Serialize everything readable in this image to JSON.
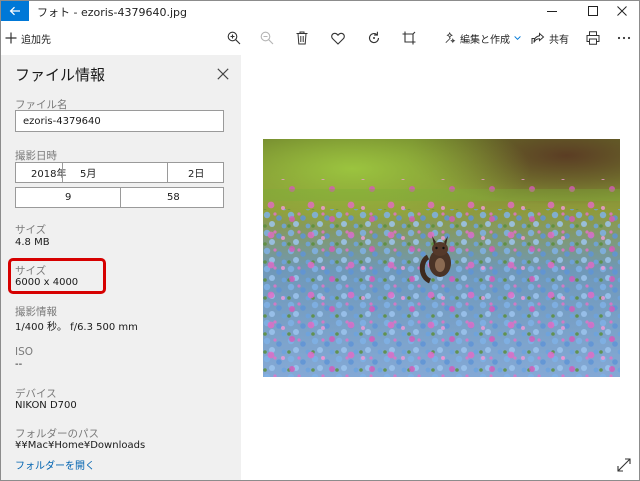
{
  "window": {
    "title": "フォト - ezoris-4379640.jpg"
  },
  "toolbar": {
    "add_label": "追加先",
    "edit_label": "編集と作成",
    "share_label": "共有",
    "icons": [
      "back-arrow-icon",
      "plus-icon",
      "zoom-in-icon",
      "zoom-out-icon",
      "trash-icon",
      "heart-icon",
      "rotate-icon",
      "crop-icon",
      "edit-create-icon",
      "chevron-down-icon",
      "share-icon",
      "print-icon",
      "more-icon",
      "minimize-icon",
      "maximize-icon",
      "close-icon",
      "expand-icon"
    ]
  },
  "panel": {
    "title": "ファイル情報",
    "file_name_label": "ファイル名",
    "file_name": "ezoris-4379640",
    "date_label": "撮影日時",
    "date_year": "2018年",
    "date_month": "5月",
    "date_day": "2日",
    "time_hour": "9",
    "time_minute": "58",
    "size_label": "サイズ",
    "size_value": "4.8 MB",
    "dimensions_label": "サイズ",
    "dimensions_value": "6000 x 4000",
    "shooting_label": "撮影情報",
    "shooting_value": "1/400 秒。 f/6.3 500 mm",
    "iso_label": "ISO",
    "iso_value": "--",
    "device_label": "デバイス",
    "device_value": "NIKON D700",
    "folder_label": "フォルダーのパス",
    "folder_value": "¥¥Mac¥Home¥Downloads",
    "open_folder_link": "フォルダーを開く"
  },
  "colors": {
    "accent": "#0078d7",
    "link": "#0063b1",
    "highlight": "#d60000",
    "panel_bg": "#f0f0f0"
  }
}
